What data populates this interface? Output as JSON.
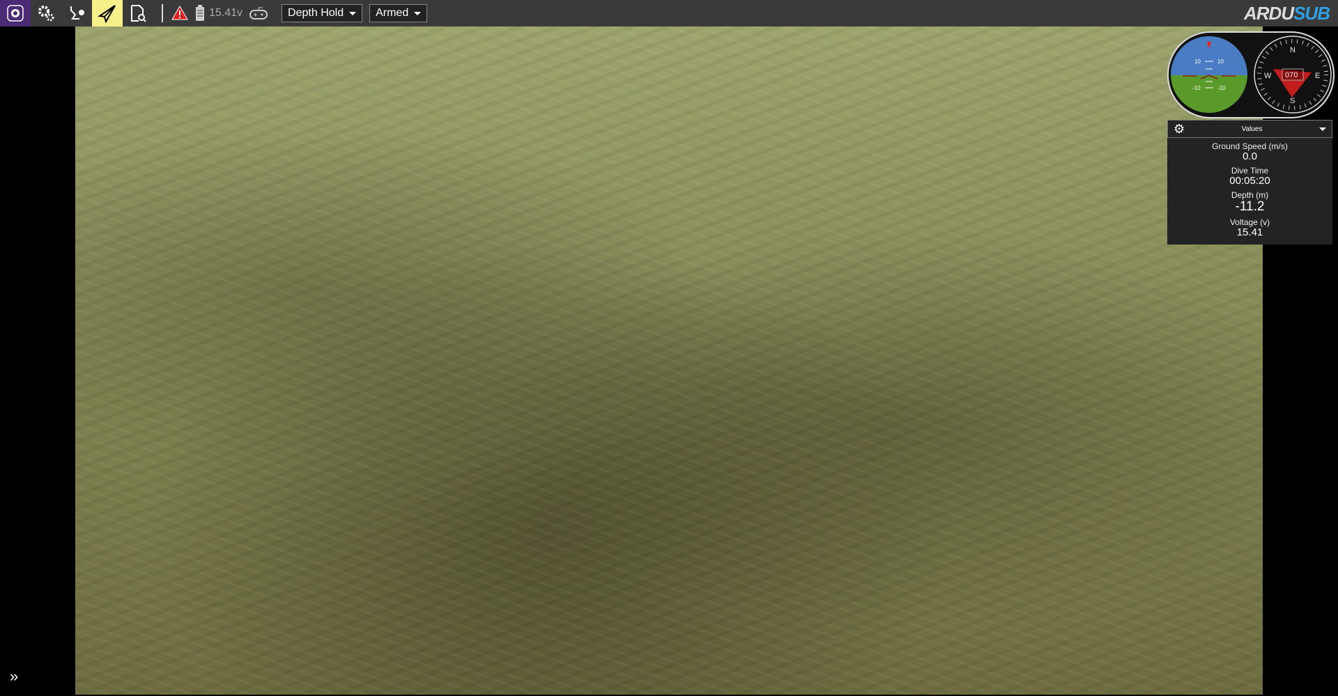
{
  "toolbar": {
    "voltage": "15.41v",
    "flight_mode": "Depth Hold",
    "arm_state": "Armed",
    "logo": "ARDUSUB",
    "logo_part1": "ARDU",
    "logo_part2": "SUB"
  },
  "instruments": {
    "pitch_labels": [
      "10",
      "10",
      "-10",
      "-10"
    ],
    "heading": "070",
    "compass": {
      "n": "N",
      "s": "S",
      "e": "E",
      "w": "W"
    }
  },
  "values_panel": {
    "title": "Values",
    "items": [
      {
        "label": "Ground Speed (m/s)",
        "value": "0.0"
      },
      {
        "label": "Dive Time",
        "value": "00:05:20"
      },
      {
        "label": "Depth (m)",
        "value": "-11.2"
      },
      {
        "label": "Voltage (v)",
        "value": "15.41"
      }
    ]
  },
  "colors": {
    "sky": "#4a7cc4",
    "ground": "#5a9a2a",
    "accent": "#f7ef8a",
    "brand": "#4b2b74",
    "sub_blue": "#2ea0e6"
  }
}
